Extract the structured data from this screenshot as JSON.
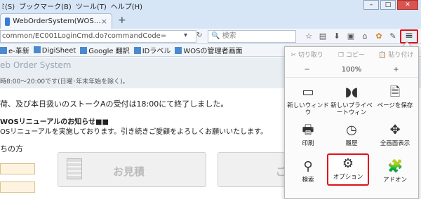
{
  "menu": {
    "items": [
      "ﾐ(S)",
      "ブックマーク(B)",
      "ツール(T)",
      "ヘルプ(H)"
    ]
  },
  "window_controls": {
    "minimize": "–",
    "maximize": "□",
    "close": "✕"
  },
  "tab": {
    "title": "WebOrderSystem(WOS…",
    "close": "×",
    "new_tab": "+"
  },
  "address": {
    "url": "common/EC001LoginCmd.do?commandCode=",
    "search_placeholder": "検索"
  },
  "bookmarks": [
    "e-革新",
    "DigiSheet",
    "Google 翻訳",
    "IDラベル",
    "WOSの管理者画面"
  ],
  "page": {
    "header_title": "eb Order System",
    "header_hours": "時8:00〜20:00です(日曜･年末年始を除く)。",
    "notice": "荷、及び本日扱いのストークAの受付は18:00にて終了しました。",
    "news_title": "WOSリニューアルのお知らせ■■",
    "news_body": "OSリニューアルを実施しております。引き続きご愛顧をよろしくお願いいたします。",
    "who": "ちの方",
    "card1_label": "お見積",
    "card2_label": "ご"
  },
  "panel": {
    "cut": "切り取り",
    "copy": "コピー",
    "paste": "貼り付け",
    "zoom_out": "−",
    "zoom_level": "100%",
    "zoom_in": "+",
    "items": [
      {
        "label": "新しいウィンドウ",
        "icon": "window-icon"
      },
      {
        "label": "新しいプライベートウィン",
        "icon": "private-mask-icon"
      },
      {
        "label": "ページを保存",
        "icon": "save-page-icon"
      },
      {
        "label": "印刷",
        "icon": "print-icon"
      },
      {
        "label": "履歴",
        "icon": "history-clock-icon"
      },
      {
        "label": "全画面表示",
        "icon": "fullscreen-icon"
      },
      {
        "label": "検索",
        "icon": "search-icon"
      },
      {
        "label": "オプション",
        "icon": "gear-icon"
      },
      {
        "label": "アドオン",
        "icon": "puzzle-icon"
      }
    ]
  }
}
